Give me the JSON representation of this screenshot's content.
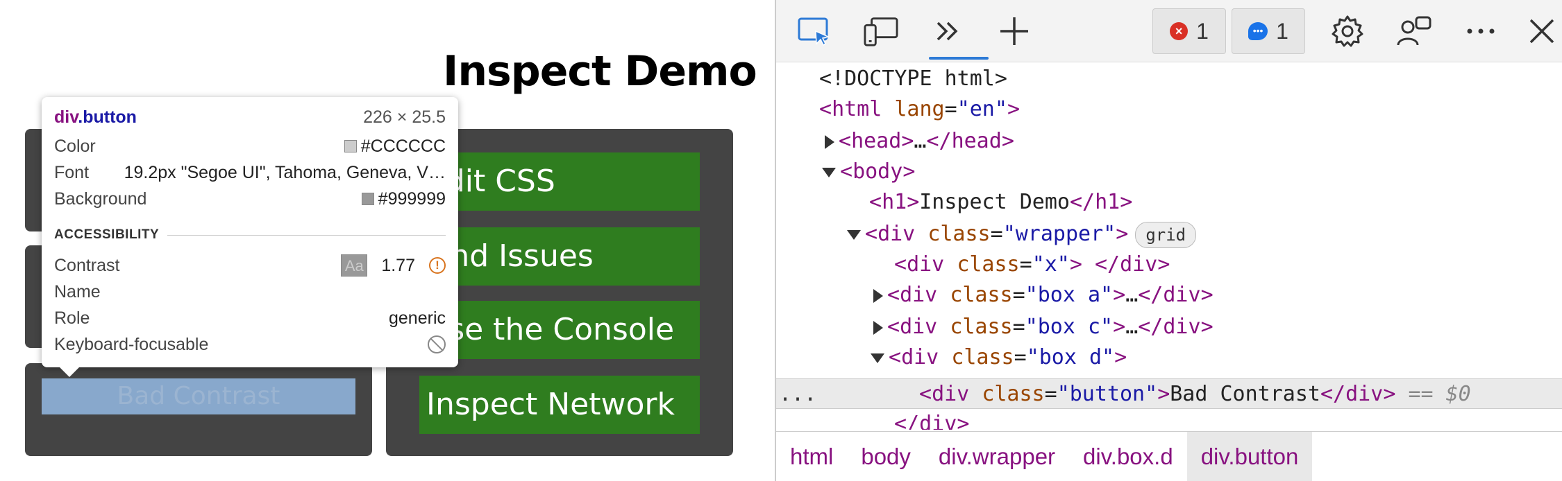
{
  "page": {
    "title": "Inspect Demo",
    "buttons": [
      "Edit CSS",
      "Find Issues",
      "Use the Console",
      "Inspect Network"
    ],
    "bad_contrast_label": "Bad Contrast"
  },
  "tooltip": {
    "selector_tag": "div",
    "selector_class": ".button",
    "dimensions": "226 × 25.5",
    "color_label": "Color",
    "color_value": "#CCCCCC",
    "font_label": "Font",
    "font_value": "19.2px \"Segoe UI\", Tahoma, Geneva, V…",
    "background_label": "Background",
    "background_value": "#999999",
    "accessibility_heading": "ACCESSIBILITY",
    "contrast_label": "Contrast",
    "contrast_badge": "Aa",
    "contrast_value": "1.77",
    "name_label": "Name",
    "role_label": "Role",
    "role_value": "generic",
    "keyboard_label": "Keyboard-focusable"
  },
  "devtools": {
    "toolbar": {
      "inspect_icon": "inspect-cursor-icon",
      "device_icon": "device-emulation-icon",
      "more_tabs_icon": "chevron-double-right-icon",
      "add_icon": "plus-icon",
      "error_count": "1",
      "message_count": "1",
      "settings_icon": "gear-icon",
      "feedback_icon": "feedback-icon",
      "overflow_icon": "more-icon",
      "close_icon": "close-icon"
    },
    "dom": {
      "doctype": "<!DOCTYPE html>",
      "html_tag": "html",
      "html_attr": "lang",
      "html_val": "\"en\"",
      "head_tag": "head",
      "body_tag": "body",
      "h1_tag": "h1",
      "h1_text": "Inspect Demo",
      "div_tag": "div",
      "class_attr": "class",
      "wrapper_val": "\"wrapper\"",
      "grid_badge": "grid",
      "x_val": "\"x\"",
      "box_a_val": "\"box a\"",
      "box_c_val": "\"box c\"",
      "box_d_val": "\"box d\"",
      "button_val": "\"button\"",
      "button_text": "Bad Contrast",
      "selected_marker": "== $0",
      "gutter_ellipsis": "..."
    },
    "breadcrumb": [
      "html",
      "body",
      "div.wrapper",
      "div.box.d",
      "div.button"
    ]
  },
  "colors": {
    "green_button": "#2f7d1f",
    "dark_box": "#444444",
    "tag": "#881280",
    "attr": "#994500",
    "value": "#1a1aa6",
    "accent": "#2d7ad6",
    "error": "#d93025",
    "swatch_color": "#CCCCCC",
    "swatch_background": "#999999"
  }
}
